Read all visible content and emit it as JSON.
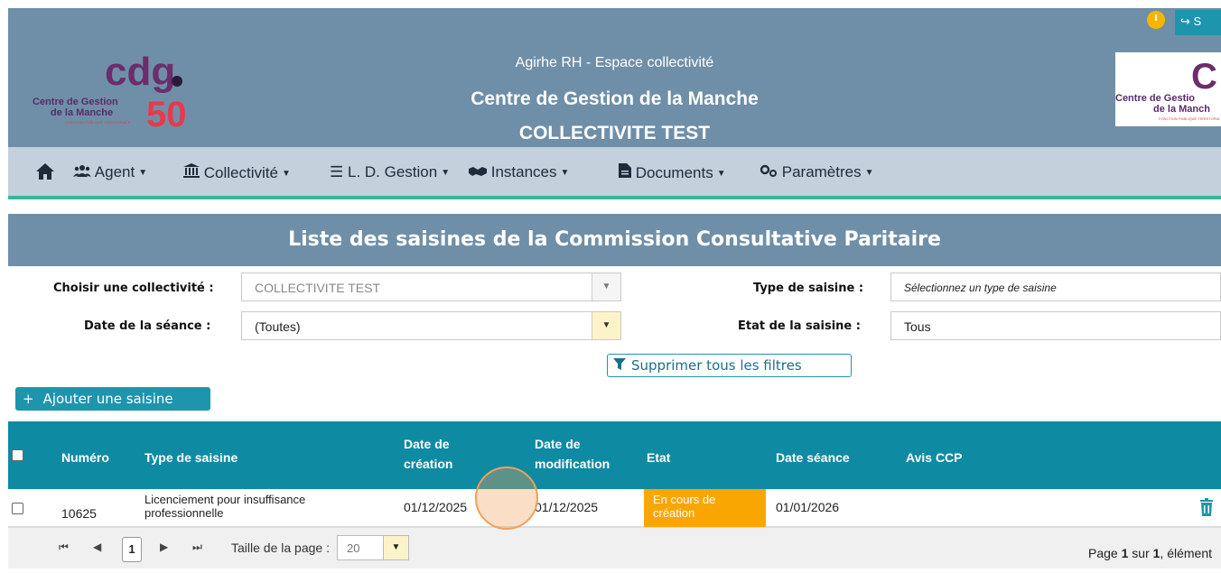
{
  "header": {
    "subtitle": "Agirhe RH - Espace collectivité",
    "title": "Centre de Gestion de la Manche",
    "collectivity": "COLLECTIVITE TEST",
    "logout_label": "S",
    "logo_left": {
      "brand": "cdg",
      "number": "50",
      "line1": "Centre de Gestion",
      "line2": "de la Manche",
      "tag": "FONCTION PUBLIQUE TERRITORIALE"
    },
    "logo_right": {
      "brand": "C",
      "line1": "Centre de Gestio",
      "line2": "de la Manch",
      "tag": "FONCTION PUBLIQUE TERRITORIA"
    }
  },
  "nav": {
    "items": [
      {
        "label": "Agent",
        "icon": "users-icon"
      },
      {
        "label": "Collectivité",
        "icon": "bank-icon"
      },
      {
        "label": "L. D. Gestion",
        "icon": "list-icon"
      },
      {
        "label": "Instances",
        "icon": "handshake-icon"
      },
      {
        "label": "Documents",
        "icon": "file-icon"
      },
      {
        "label": "Paramètres",
        "icon": "cogs-icon"
      }
    ]
  },
  "page": {
    "title": "Liste des saisines de la Commission Consultative Paritaire"
  },
  "filters": {
    "collectivite_label": "Choisir une collectivité :",
    "collectivite_value": "COLLECTIVITE TEST",
    "date_label": "Date de la séance :",
    "date_value": "(Toutes)",
    "type_label": "Type de saisine :",
    "type_placeholder": "Sélectionnez un type de saisine",
    "etat_label": "Etat de la saisine :",
    "etat_value": "Tous",
    "clear_label": "Supprimer tous les filtres"
  },
  "add_button": {
    "label": "Ajouter une saisine"
  },
  "table": {
    "headers": {
      "numero": "Numéro",
      "type": "Type de saisine",
      "date_creation_1": "Date de",
      "date_creation_2": "création",
      "date_modif_1": "Date de",
      "date_modif_2": "modification",
      "etat": "Etat",
      "date_seance": "Date séance",
      "avis": "Avis CCP"
    },
    "rows": [
      {
        "numero": "10625",
        "type_1": "Licenciement pour insuffisance",
        "type_2": "professionnelle",
        "date_creation": "01/12/2025",
        "date_modification": "01/12/2025",
        "etat_1": "En cours de",
        "etat_2": "création",
        "date_seance": "01/01/2026",
        "avis": ""
      }
    ]
  },
  "pager": {
    "current_page": "1",
    "size_label": "Taille de la page :",
    "size_value": "20",
    "info_prefix": "Page ",
    "info_page": "1",
    "info_mid": " sur ",
    "info_total": "1",
    "info_suffix": ", élément"
  },
  "colors": {
    "banner": "#6f8fa8",
    "nav": "#c4d1dc",
    "accent": "#1d95ad",
    "table_header": "#0f8aa3",
    "status_orange": "#f9a602"
  }
}
